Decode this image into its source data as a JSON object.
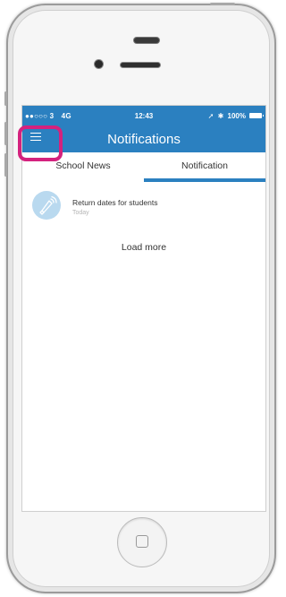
{
  "status_bar": {
    "carrier": "●●○○○ 3",
    "network": "4G",
    "time": "12:43",
    "battery": "100%"
  },
  "header": {
    "title": "Notifications",
    "menu_icon": "hamburger-menu-icon"
  },
  "tabs": [
    {
      "label": "School News",
      "active": false
    },
    {
      "label": "Notification",
      "active": true
    }
  ],
  "notifications": [
    {
      "title": "Return dates for students",
      "time": "Today",
      "icon": "megaphone-icon"
    }
  ],
  "actions": {
    "load_more": "Load more"
  },
  "colors": {
    "accent": "#2b80c0",
    "highlight": "#d4227e",
    "avatar_bg": "#b9d9ef"
  }
}
